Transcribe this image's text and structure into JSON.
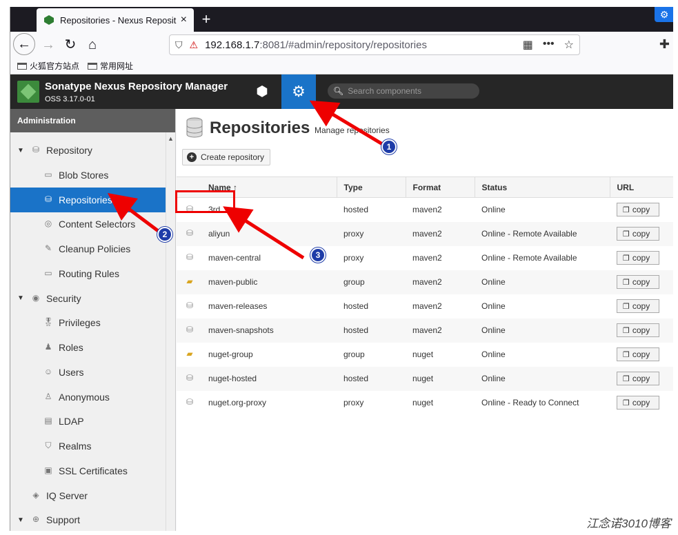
{
  "browser": {
    "tab_title": "Repositories - Nexus Reposit",
    "tab_close": "×",
    "new_tab": "+",
    "url_host": "192.168.1.7",
    "url_rest": ":8081/#admin/repository/repositories",
    "bookmarks": [
      "火狐官方站点",
      "常用网址"
    ]
  },
  "nexus": {
    "title": "Sonatype Nexus Repository Manager",
    "version": "OSS 3.17.0-01",
    "search_placeholder": "Search components"
  },
  "sidebar": {
    "header": "Administration",
    "items": [
      {
        "label": "Repository",
        "level": 0,
        "icon": "database-icon",
        "expanded": true
      },
      {
        "label": "Blob Stores",
        "level": 1,
        "icon": "hdd-icon"
      },
      {
        "label": "Repositories",
        "level": 1,
        "icon": "database-icon",
        "active": true
      },
      {
        "label": "Content Selectors",
        "level": 1,
        "icon": "content-selector-icon"
      },
      {
        "label": "Cleanup Policies",
        "level": 1,
        "icon": "broom-icon"
      },
      {
        "label": "Routing Rules",
        "level": 1,
        "icon": "hdd-icon"
      },
      {
        "label": "Security",
        "level": 0,
        "icon": "eye-icon",
        "expanded": true
      },
      {
        "label": "Privileges",
        "level": 1,
        "icon": "medal-icon"
      },
      {
        "label": "Roles",
        "level": 1,
        "icon": "user-tie-icon"
      },
      {
        "label": "Users",
        "level": 1,
        "icon": "users-icon"
      },
      {
        "label": "Anonymous",
        "level": 1,
        "icon": "user-icon"
      },
      {
        "label": "LDAP",
        "level": 1,
        "icon": "book-icon"
      },
      {
        "label": "Realms",
        "level": 1,
        "icon": "shield-icon"
      },
      {
        "label": "SSL Certificates",
        "level": 1,
        "icon": "certificate-icon"
      },
      {
        "label": "IQ Server",
        "level": 0,
        "icon": "iq-icon"
      },
      {
        "label": "Support",
        "level": 0,
        "icon": "lifebuoy-icon",
        "expanded": true
      }
    ]
  },
  "main": {
    "title": "Repositories",
    "subtitle": "Manage repositories",
    "create_button": "Create repository",
    "columns": [
      "Name ↑",
      "Type",
      "Format",
      "Status",
      "URL"
    ],
    "copy_label": "copy",
    "rows": [
      {
        "name": "3rd",
        "type": "hosted",
        "format": "maven2",
        "status": "Online",
        "icon": "database-icon"
      },
      {
        "name": "aliyun",
        "type": "proxy",
        "format": "maven2",
        "status": "Online - Remote Available",
        "icon": "proxy-icon"
      },
      {
        "name": "maven-central",
        "type": "proxy",
        "format": "maven2",
        "status": "Online - Remote Available",
        "icon": "proxy-icon"
      },
      {
        "name": "maven-public",
        "type": "group",
        "format": "maven2",
        "status": "Online",
        "icon": "group-folder-icon"
      },
      {
        "name": "maven-releases",
        "type": "hosted",
        "format": "maven2",
        "status": "Online",
        "icon": "database-icon"
      },
      {
        "name": "maven-snapshots",
        "type": "hosted",
        "format": "maven2",
        "status": "Online",
        "icon": "database-icon"
      },
      {
        "name": "nuget-group",
        "type": "group",
        "format": "nuget",
        "status": "Online",
        "icon": "group-folder-icon"
      },
      {
        "name": "nuget-hosted",
        "type": "hosted",
        "format": "nuget",
        "status": "Online",
        "icon": "database-icon"
      },
      {
        "name": "nuget.org-proxy",
        "type": "proxy",
        "format": "nuget",
        "status": "Online - Ready to Connect",
        "icon": "proxy-icon"
      }
    ]
  },
  "annotations": {
    "markers": [
      "1",
      "2",
      "3"
    ]
  },
  "watermark": "江念诺3010博客"
}
